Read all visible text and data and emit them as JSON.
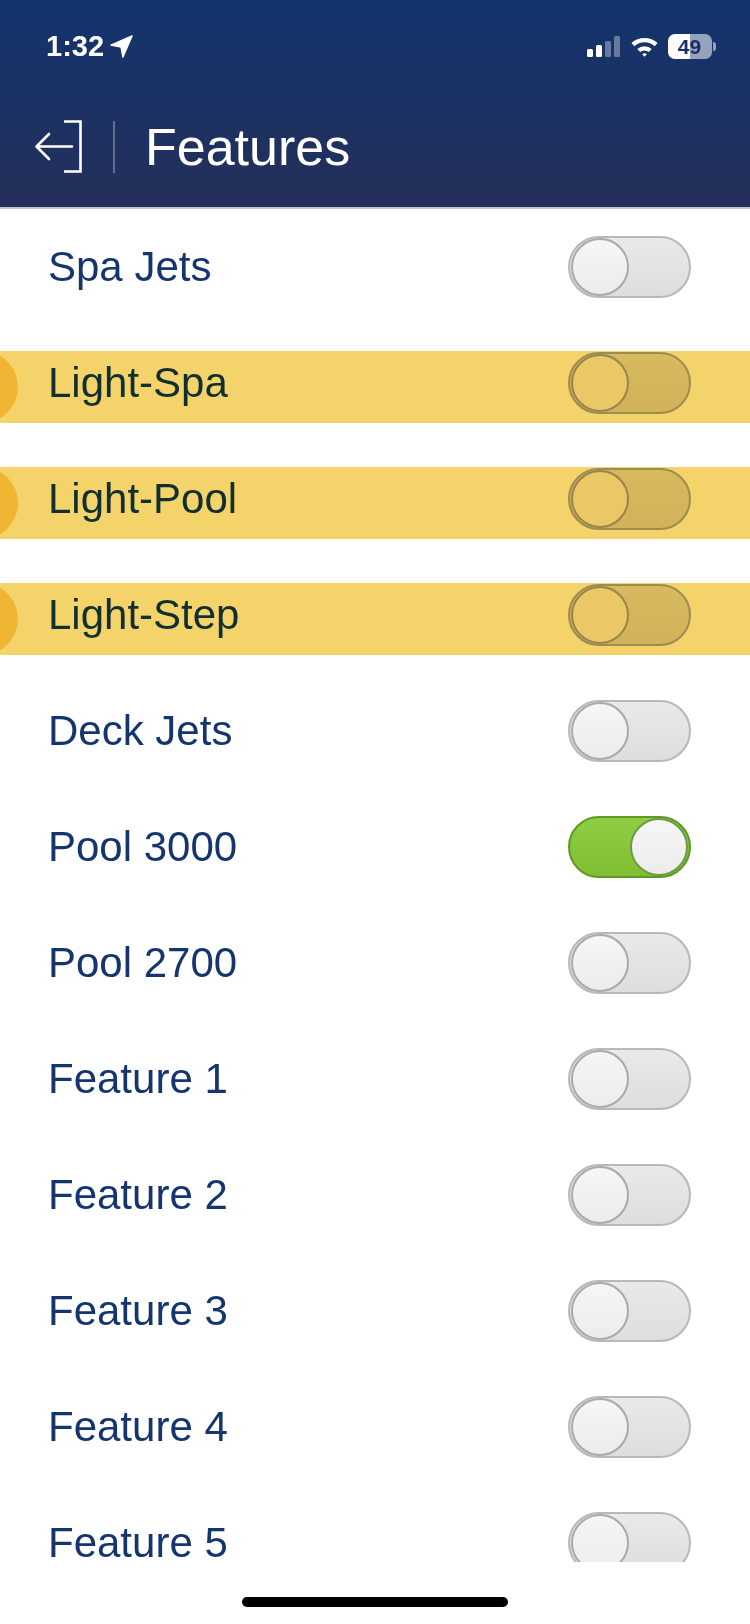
{
  "status_bar": {
    "time": "1:32",
    "battery": "49"
  },
  "header": {
    "title": "Features"
  },
  "features": [
    {
      "name": "Spa Jets",
      "on": false,
      "highlighted": false
    },
    {
      "name": "Light-Spa",
      "on": false,
      "highlighted": true
    },
    {
      "name": "Light-Pool",
      "on": false,
      "highlighted": true
    },
    {
      "name": "Light-Step",
      "on": false,
      "highlighted": true
    },
    {
      "name": "Deck Jets",
      "on": false,
      "highlighted": false
    },
    {
      "name": "Pool 3000",
      "on": true,
      "highlighted": false
    },
    {
      "name": "Pool 2700",
      "on": false,
      "highlighted": false
    },
    {
      "name": "Feature 1",
      "on": false,
      "highlighted": false
    },
    {
      "name": "Feature 2",
      "on": false,
      "highlighted": false
    },
    {
      "name": "Feature 3",
      "on": false,
      "highlighted": false
    },
    {
      "name": "Feature 4",
      "on": false,
      "highlighted": false
    },
    {
      "name": "Feature 5",
      "on": false,
      "highlighted": false
    }
  ]
}
